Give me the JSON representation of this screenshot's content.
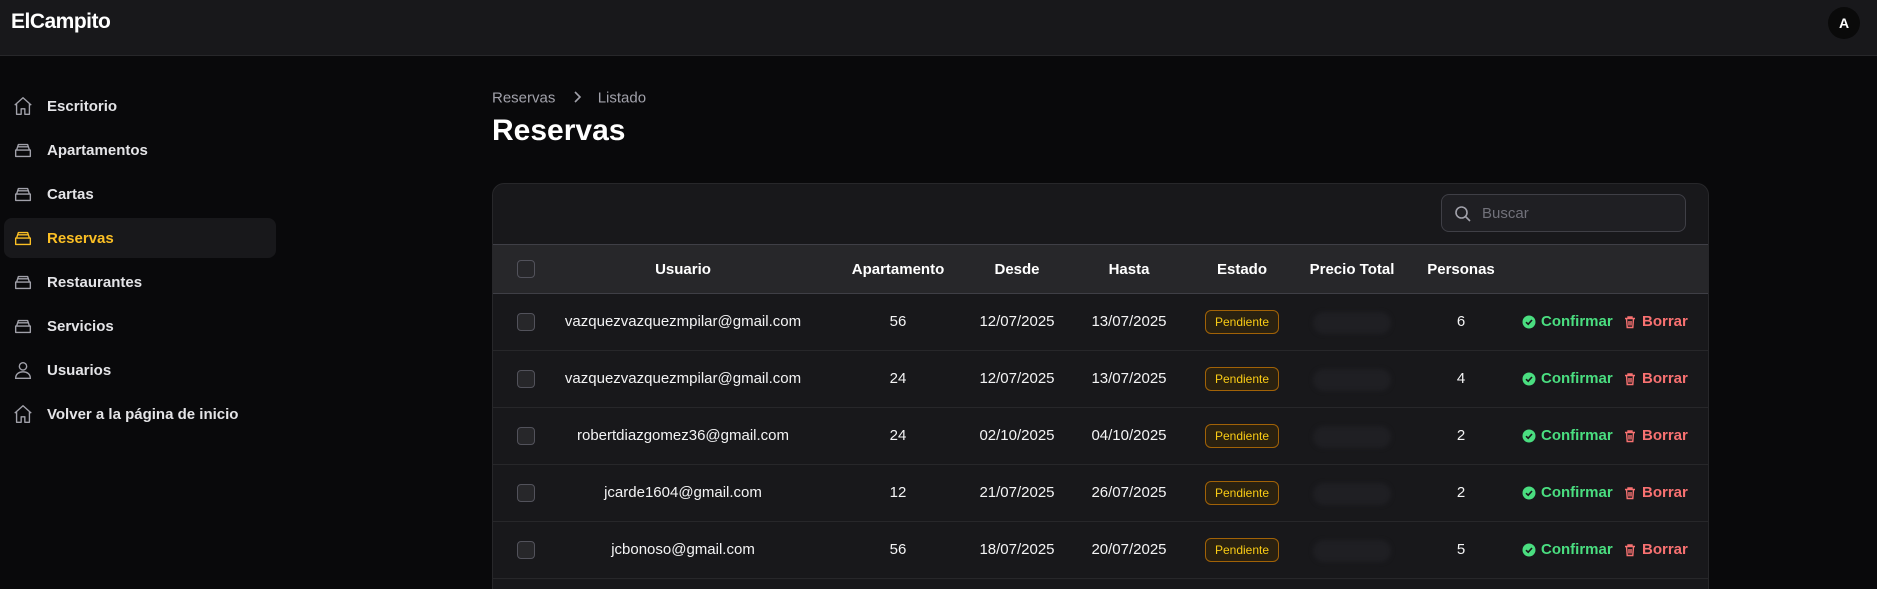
{
  "app": {
    "brand": "ElCampito",
    "avatar_initial": "A"
  },
  "sidebar": {
    "items": [
      {
        "label": "Escritorio",
        "icon": "home-icon",
        "active": false
      },
      {
        "label": "Apartamentos",
        "icon": "inbox-stack-icon",
        "active": false
      },
      {
        "label": "Cartas",
        "icon": "inbox-stack-icon",
        "active": false
      },
      {
        "label": "Reservas",
        "icon": "inbox-stack-icon",
        "active": true
      },
      {
        "label": "Restaurantes",
        "icon": "inbox-stack-icon",
        "active": false
      },
      {
        "label": "Servicios",
        "icon": "inbox-stack-icon",
        "active": false
      },
      {
        "label": "Usuarios",
        "icon": "user-icon",
        "active": false
      },
      {
        "label": "Volver a la página de inicio",
        "icon": "home-icon",
        "active": false
      }
    ]
  },
  "breadcrumb": {
    "items": [
      "Reservas",
      "Listado"
    ]
  },
  "page": {
    "title": "Reservas"
  },
  "search": {
    "placeholder": "Buscar",
    "value": ""
  },
  "table": {
    "headers": {
      "usuario": "Usuario",
      "apartamento": "Apartamento",
      "desde": "Desde",
      "hasta": "Hasta",
      "estado": "Estado",
      "precio": "Precio Total",
      "personas": "Personas"
    },
    "rows": [
      {
        "usuario": "vazquezvazquezmpilar@gmail.com",
        "apartamento": "56",
        "desde": "12/07/2025",
        "hasta": "13/07/2025",
        "estado": "Pendiente",
        "personas": "6"
      },
      {
        "usuario": "vazquezvazquezmpilar@gmail.com",
        "apartamento": "24",
        "desde": "12/07/2025",
        "hasta": "13/07/2025",
        "estado": "Pendiente",
        "personas": "4"
      },
      {
        "usuario": "robertdiazgomez36@gmail.com",
        "apartamento": "24",
        "desde": "02/10/2025",
        "hasta": "04/10/2025",
        "estado": "Pendiente",
        "personas": "2"
      },
      {
        "usuario": "jcarde1604@gmail.com",
        "apartamento": "12",
        "desde": "21/07/2025",
        "hasta": "26/07/2025",
        "estado": "Pendiente",
        "personas": "2"
      },
      {
        "usuario": "jcbonoso@gmail.com",
        "apartamento": "56",
        "desde": "18/07/2025",
        "hasta": "20/07/2025",
        "estado": "Pendiente",
        "personas": "5"
      }
    ],
    "actions": {
      "confirm_label": "Confirmar",
      "delete_label": "Borrar"
    }
  },
  "colors": {
    "accent": "#fbbf24",
    "confirm": "#4ade80",
    "delete": "#f87171",
    "badge_pending": "#facc15"
  }
}
